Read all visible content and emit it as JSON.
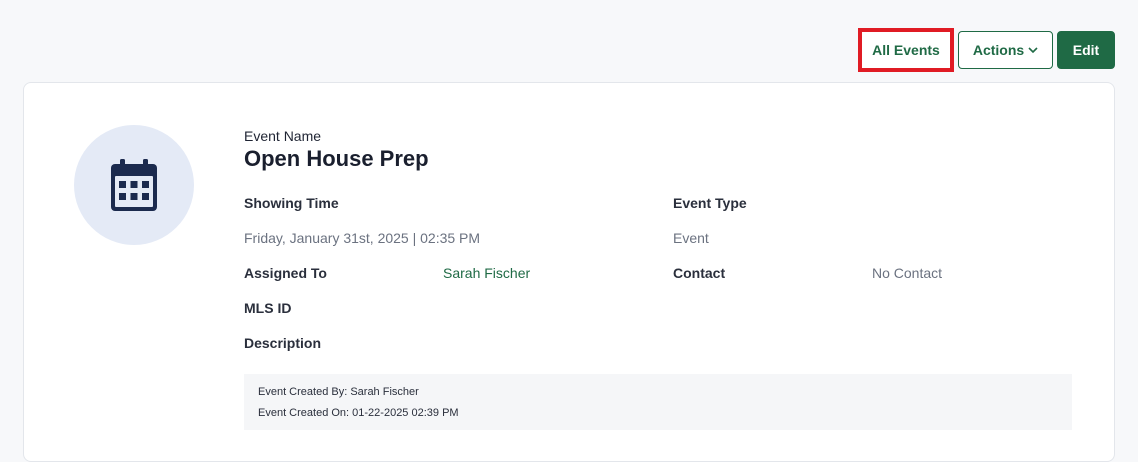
{
  "toolbar": {
    "all_events_label": "All Events",
    "actions_label": "Actions",
    "edit_label": "Edit"
  },
  "event": {
    "name_label": "Event Name",
    "name": "Open House Prep",
    "showing_time_label": "Showing Time",
    "showing_time": "Friday, January 31st, 2025 | 02:35 PM",
    "event_type_label": "Event Type",
    "event_type": "Event",
    "assigned_to_label": "Assigned To",
    "assigned_to": "Sarah Fischer",
    "contact_label": "Contact",
    "contact": "No Contact",
    "mls_id_label": "MLS ID",
    "description_label": "Description",
    "created_by": "Event Created By: Sarah Fischer",
    "created_on": "Event Created On: 01-22-2025 02:39 PM"
  },
  "icons": {
    "avatar": "calendar-icon",
    "actions_dropdown": "chevron-down-icon"
  },
  "colors": {
    "brand_green": "#1f6a45",
    "highlight_red": "#e01b24",
    "avatar_bg": "#e4eaf6",
    "icon_navy": "#1b2a4e"
  }
}
